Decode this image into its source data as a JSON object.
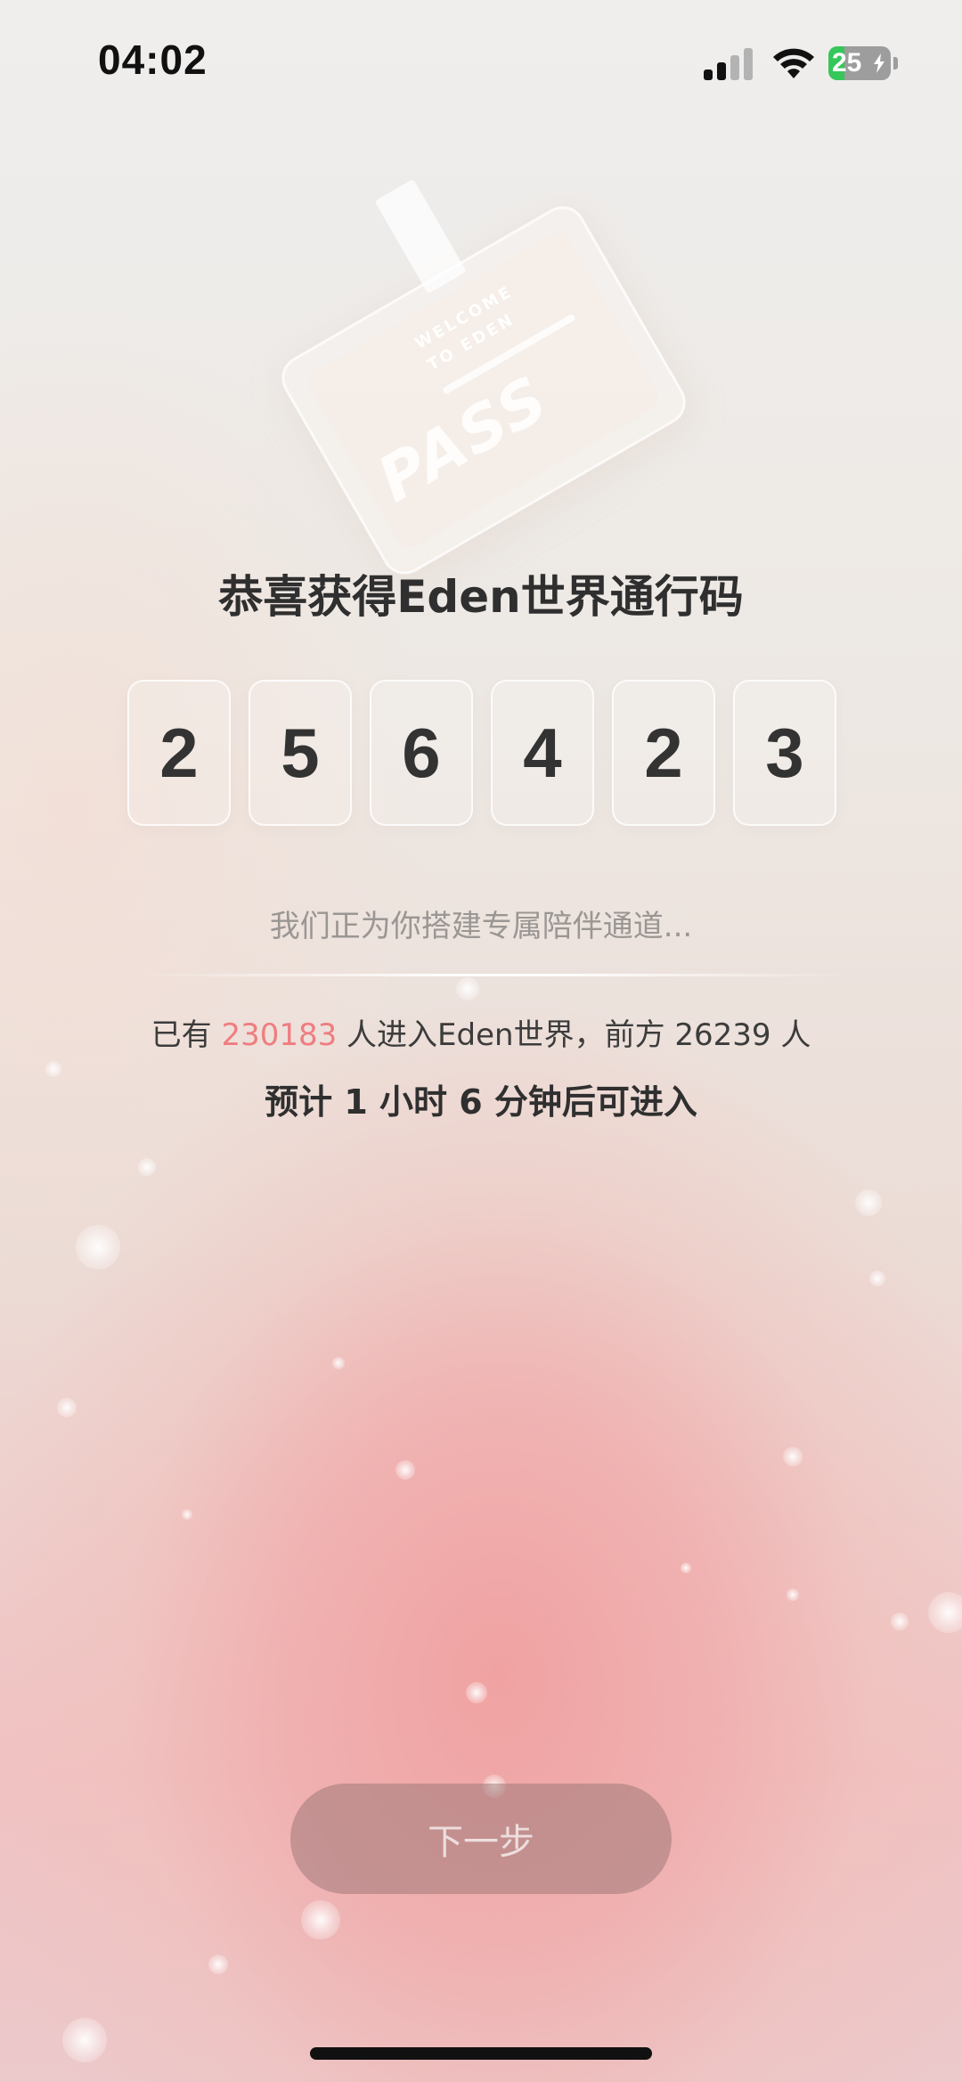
{
  "status_bar": {
    "time": "04:02",
    "battery_level": "25",
    "signal_bars_active": 2,
    "signal_bars_total": 4
  },
  "pass_card": {
    "welcome_line1": "WELCOME",
    "welcome_line2": "TO EDEN",
    "label": "PASS"
  },
  "header": {
    "title": "恭喜获得Eden世界通行码"
  },
  "code": {
    "digits": [
      "2",
      "5",
      "6",
      "4",
      "2",
      "3"
    ]
  },
  "status": {
    "building": "我们正为你搭建专属陪伴通道..."
  },
  "queue": {
    "prefix": "已有",
    "entered_count": "230183",
    "middle": "人进入Eden世界，前方",
    "ahead_count": "26239",
    "suffix": "人",
    "estimate": "预计 1 小时 6 分钟后可进入"
  },
  "footer": {
    "next_label": "下一步"
  },
  "colors": {
    "accent": "#ef7d80",
    "button_bg": "#a07878",
    "battery_green": "#35c759"
  }
}
